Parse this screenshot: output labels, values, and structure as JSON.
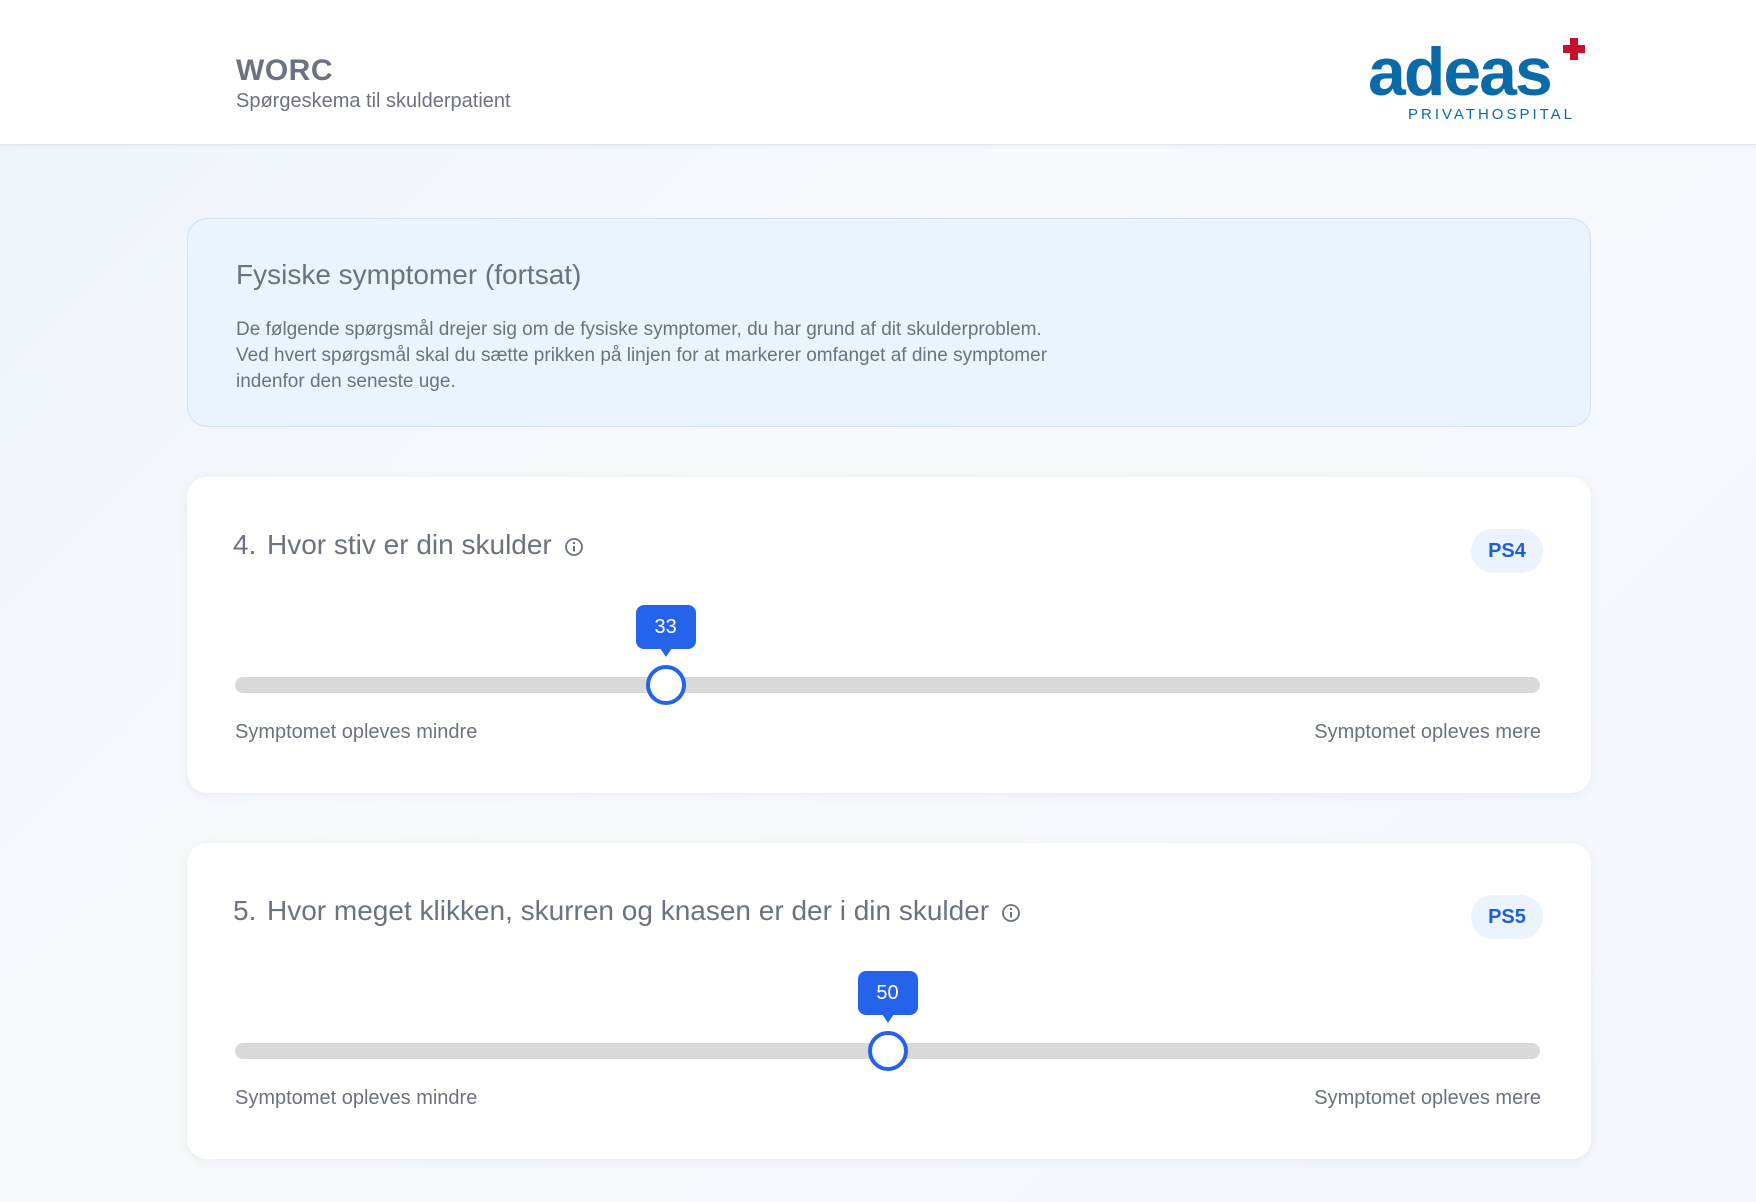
{
  "header": {
    "title": "WORC",
    "subtitle": "Spørgeskema til skulderpatient",
    "logo": {
      "word": "adeas",
      "sub": "PRIVATHOSPITAL",
      "brand_color": "#0b6aa8",
      "cross_color": "#c8102e"
    }
  },
  "intro": {
    "title": "Fysiske symptomer (fortsat)",
    "lines": [
      "De følgende spørgsmål drejer sig om de fysiske symptomer, du har grund af dit skulderproblem.",
      "Ved hvert spørgsmål skal du sætte prikken på linjen for at markerer omfanget af dine symptomer",
      "indenfor den seneste uge."
    ]
  },
  "questions": [
    {
      "number": "4.",
      "text": "Hvor stiv er din skulder",
      "code": "PS4",
      "value": 33,
      "value_label": "33",
      "min_label": "Symptomet opleves mindre",
      "max_label": "Symptomet opleves mere"
    },
    {
      "number": "5.",
      "text": "Hvor meget klikken, skurren og knasen er der i din skulder",
      "code": "PS5",
      "value": 50,
      "value_label": "50",
      "min_label": "Symptomet opleves mindre",
      "max_label": "Symptomet opleves mere"
    }
  ],
  "colors": {
    "accent": "#2563eb",
    "track": "#d9d9d9",
    "badge_bg": "#eaf3fe"
  }
}
